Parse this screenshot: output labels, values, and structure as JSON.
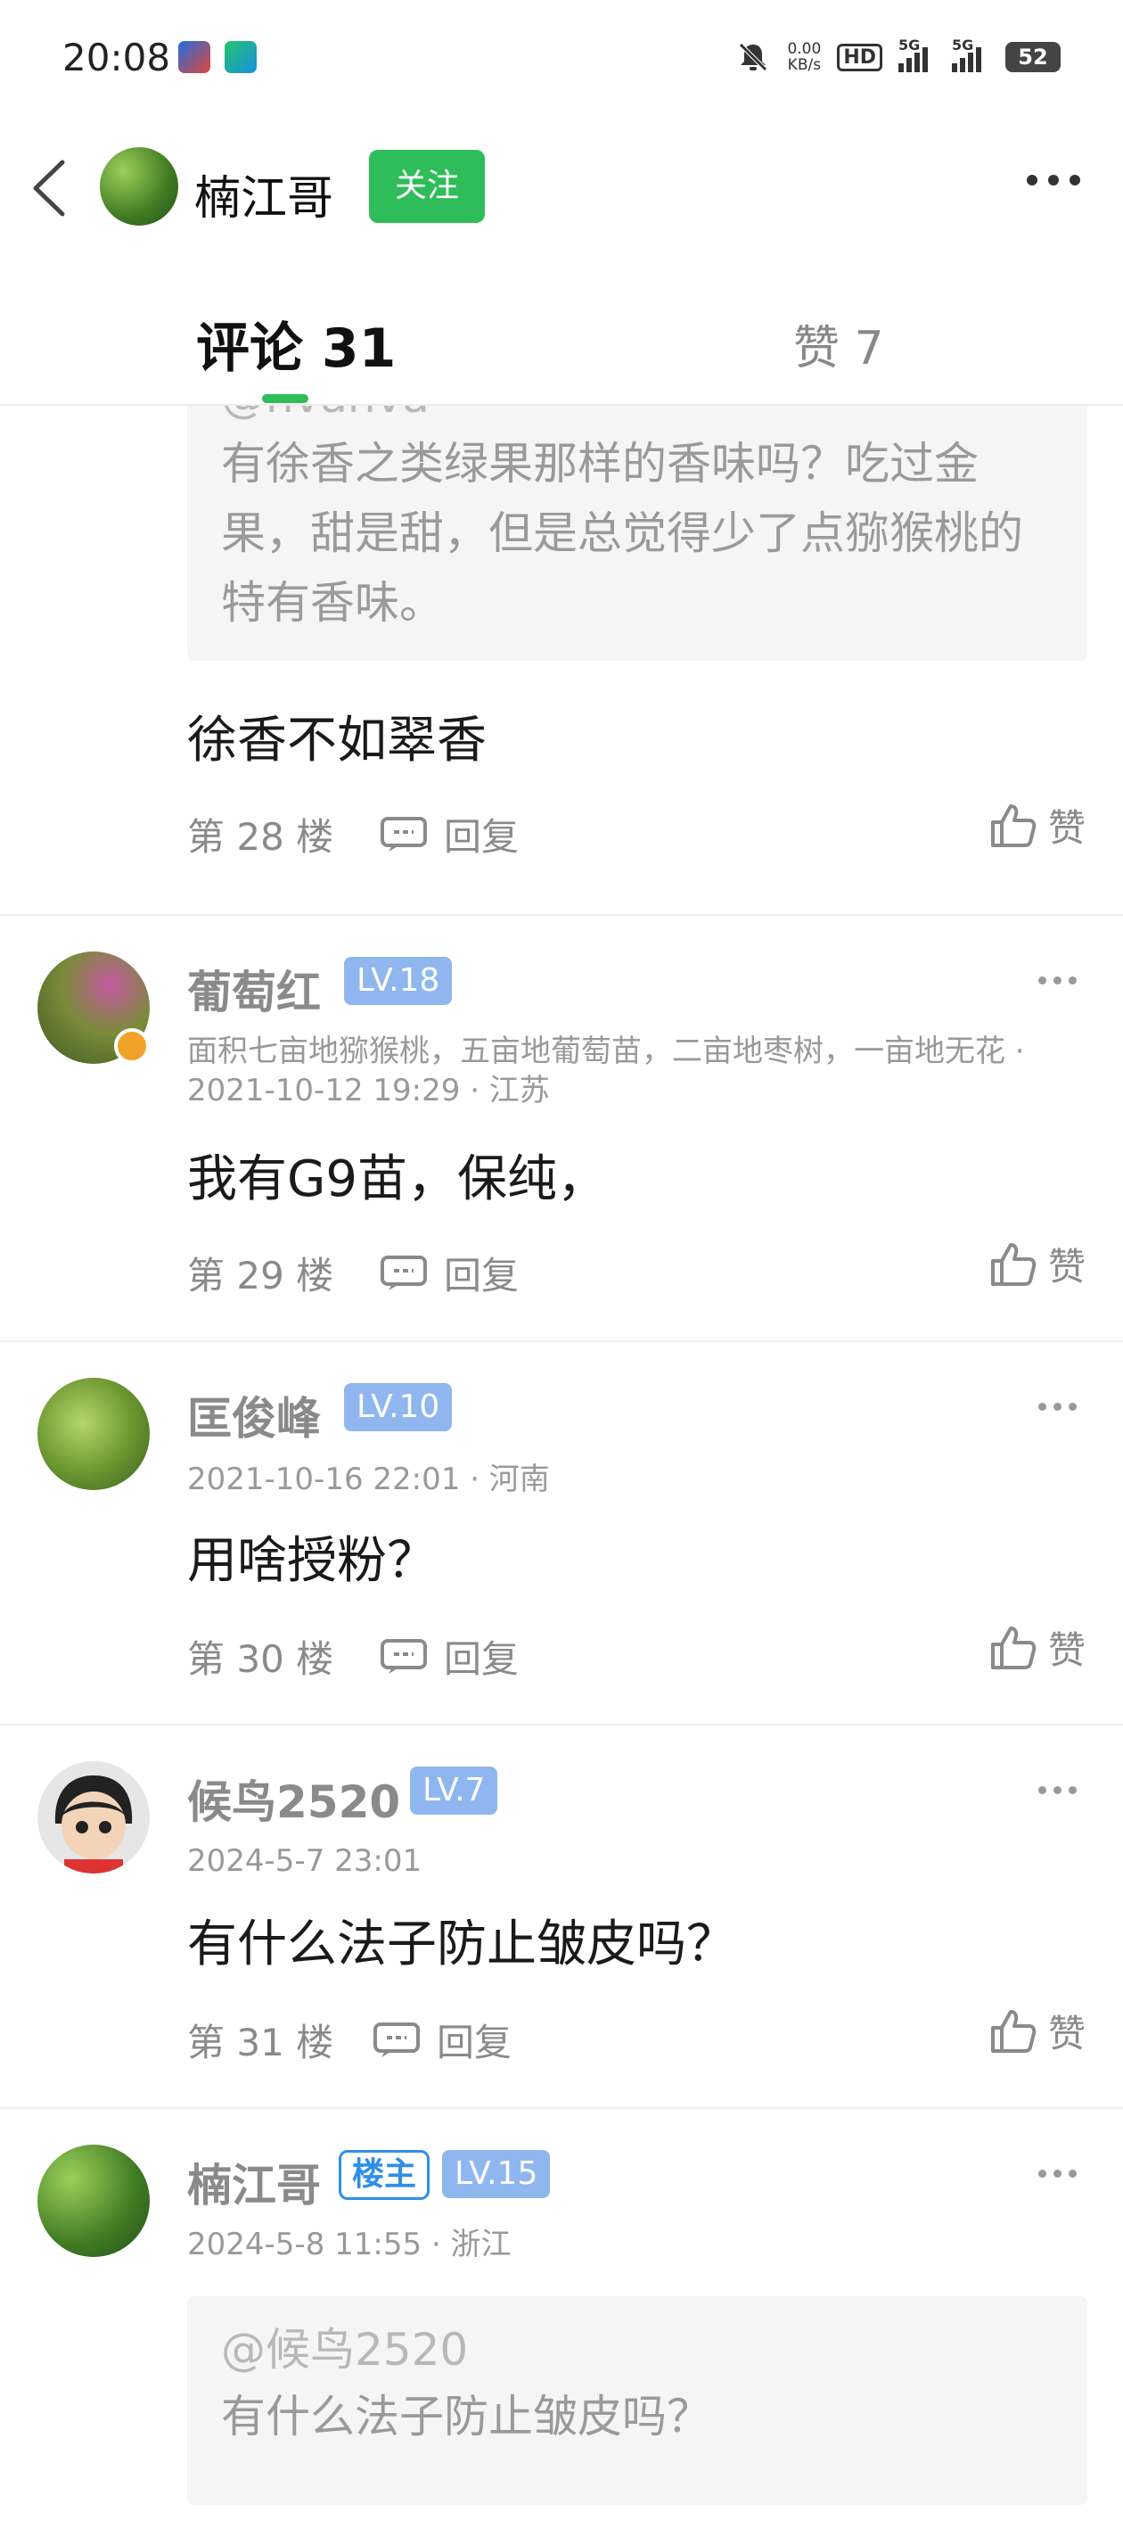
{
  "status_bar": {
    "time": "20:08",
    "net_speed_value": "0.00",
    "net_speed_unit": "KB/s",
    "hd_label": "HD",
    "signal1": "5G",
    "signal2": "5G",
    "battery": "52",
    "icons": [
      "app-icon",
      "app-icon",
      "mute-icon",
      "signal-icon",
      "signal-icon",
      "battery-icon"
    ]
  },
  "header": {
    "user_name": "楠江哥",
    "follow_label": "关注"
  },
  "tabs": {
    "comments_label": "评论 31",
    "likes_label": "赞 7"
  },
  "comments": [
    {
      "quote_user": "@hvanva",
      "quote_text": "有徐香之类绿果那样的香味吗？吃过金果，甜是甜，但是总觉得少了点猕猴桃的特有香味。",
      "text": "徐香不如翠香",
      "floor": "第 28 楼",
      "reply_label": "回复",
      "like_label": "赞"
    },
    {
      "user": "葡萄红",
      "level": "LV.18",
      "meta": "面积七亩地猕猴桃，五亩地葡萄苗，二亩地枣树，一亩地无花 · 2021-10-12 19:29 · 江苏",
      "text": "我有G9苗，保纯，",
      "floor": "第 29 楼",
      "reply_label": "回复",
      "like_label": "赞"
    },
    {
      "user": "匡俊峰",
      "level": "LV.10",
      "meta": "2021-10-16 22:01 · 河南",
      "text": "用啥授粉？",
      "floor": "第 30 楼",
      "reply_label": "回复",
      "like_label": "赞"
    },
    {
      "user": "候鸟2520",
      "level": "LV.7",
      "meta": "2024-5-7 23:01",
      "text": "有什么法子防止皱皮吗？",
      "floor": "第 31 楼",
      "reply_label": "回复",
      "like_label": "赞"
    },
    {
      "user": "楠江哥",
      "owner_badge": "楼主",
      "level": "LV.15",
      "meta": "2024-5-8 11:55 · 浙江",
      "quote_user": "@候鸟2520",
      "quote_text": "有什么法子防止皱皮吗？"
    }
  ],
  "colors": {
    "accent_green": "#2ebd59",
    "level_badge": "#8fb6ef",
    "owner_badge": "#2f8ee8"
  }
}
